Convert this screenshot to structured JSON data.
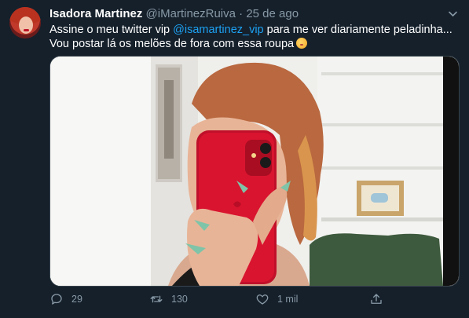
{
  "tweet": {
    "author_name": "Isadora Martinez",
    "handle": "@iMartinezRuiva",
    "separator": "·",
    "date": "25 de ago",
    "text_line1_before": "Assine o meu twitter vip ",
    "mention": "@isamartinez_vip",
    "text_line1_after": " para me ver diariamente peladinha...",
    "text_line2": "Vou postar lá os melões de fora com essa roupa",
    "emoji": "kissing-face-emoji"
  },
  "actions": {
    "reply_count": "29",
    "retweet_count": "130",
    "like_count": "1 mil"
  },
  "icons": {
    "menu": "chevron-down-icon",
    "reply": "reply-icon",
    "retweet": "retweet-icon",
    "like": "heart-icon",
    "share": "share-icon"
  },
  "colors": {
    "background": "#15202b",
    "secondary_text": "#8899a6",
    "link": "#1da1f2",
    "border": "#38444d"
  }
}
